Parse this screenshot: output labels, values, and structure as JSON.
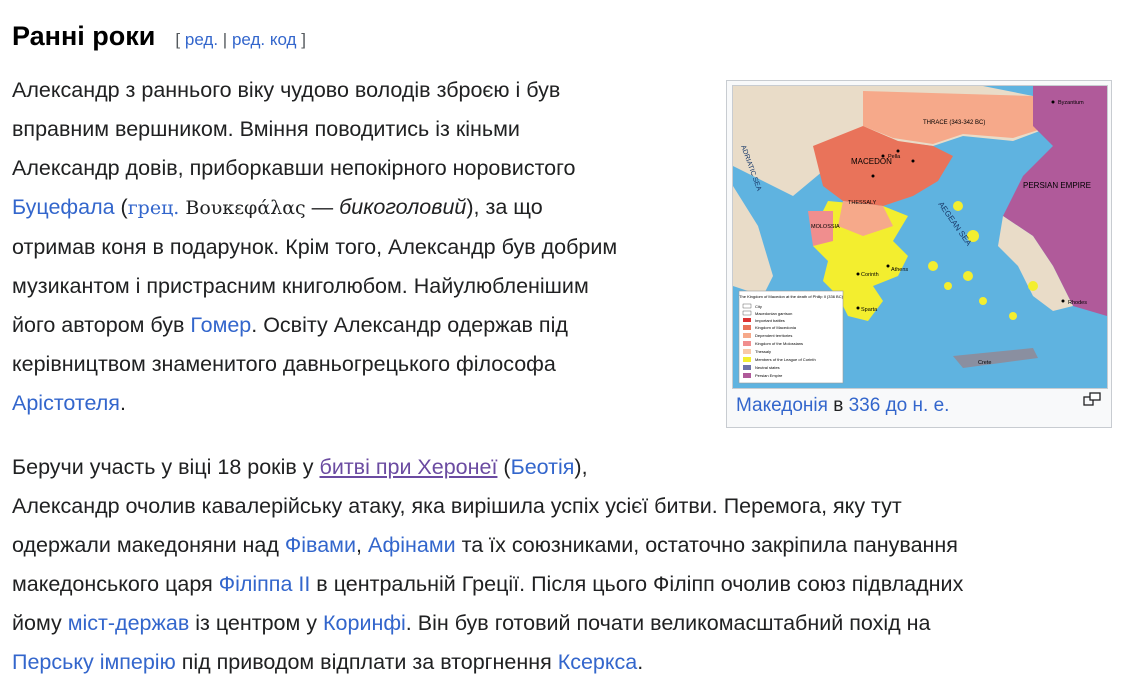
{
  "section": {
    "title": "Ранні роки",
    "edit_open": "[",
    "edit_label": "ред.",
    "edit_sep": "|",
    "edit_code_label": "ред. код",
    "edit_close": "]"
  },
  "paragraph1": {
    "t1": "Александр з раннього віку чудово володів зброєю і був",
    "t2": "вправним вершником. Вміння поводитись із кіньми",
    "t3": "Александр довів, приборкавши непокірного норовистого",
    "link_bucephalus": "Буцефала",
    "t4": " (",
    "link_greek": "грец.",
    "greek_word": " Βουκεφάλας",
    "t5": " — ",
    "meaning": "бикоголовий",
    "t6": "), за що",
    "t7": "отримав коня в подарунок. Крім того, Александр був добрим",
    "t8": "музикантом і пристрасним книголюбом. Найулюбленішим",
    "t9": "його автором був ",
    "link_homer": "Гомер",
    "t10": ". Освіту Александр одержав під",
    "t11": "керівництвом знаменитого давньогрецького філософа",
    "link_aristotle": "Арістотеля",
    "t12": "."
  },
  "figure": {
    "caption_link1": "Македонія",
    "caption_mid": " в ",
    "caption_link2": "336 до н. е.",
    "map_labels": {
      "thrace": "THRACE (343-342 BC)",
      "macedon": "MACEDON",
      "persian_empire": "PERSIAN EMPIRE",
      "aegean_sea": "AEGEAN SEA",
      "adriatic_sea": "ADRIATIC SEA",
      "molossia": "MOLOSSIA",
      "thessaly": "THESSALY",
      "byzantium": "Byzantium",
      "pella": "Pella",
      "athens": "Athens",
      "sparta": "Sparta",
      "corinth": "Corinth",
      "rhodes": "Rhodes",
      "crete": "Crete"
    },
    "legend": {
      "title": "The Kingdom of Macedon at the death of Philip II (336 BC)",
      "items": [
        "City",
        "Macedonian garrison",
        "Important battles",
        "Kingdom of Macedonia",
        "Dependent territories",
        "Kingdom of the Molossians",
        "Thessaly",
        "Members of the League of Corinth",
        "Neutral states",
        "Persian Empire"
      ]
    },
    "colors": {
      "sea": "#5fb3e0",
      "macedon": "#e9735a",
      "dependent": "#f6a98a",
      "league": "#f3ee2f",
      "persia": "#b05a9a",
      "land": "#e9dcc8"
    }
  },
  "paragraph2": {
    "t1": "Беручи участь у віці 18 років у ",
    "link_battle": "битві при Херонеї",
    "t2": " (",
    "link_boeotia": "Беотія",
    "t3": "),",
    "t4": "Александр очолив кавалерійську атаку, яка вирішила успіх усієї битви. Перемога, яку тут",
    "t5": "одержали македоняни над ",
    "link_thebes": "Фівами",
    "t6": ", ",
    "link_athens": "Афінами",
    "t7": " та їх союзниками, остаточно закріпила панування",
    "t8": "македонського царя ",
    "link_philip": "Філіппа II",
    "t9": " в центральній Греції. Після цього Філіпп очолив союз підвладних",
    "t10": "йому ",
    "link_cities": "міст-держав",
    "t11": " із центром у ",
    "link_corinth": "Коринфі",
    "t12": ". Він був готовий почати великомасштабний похід на",
    "link_persia": "Перську імперію",
    "t13": " під приводом відплати за вторгнення ",
    "link_xerxes": "Ксеркса",
    "t14": "."
  }
}
